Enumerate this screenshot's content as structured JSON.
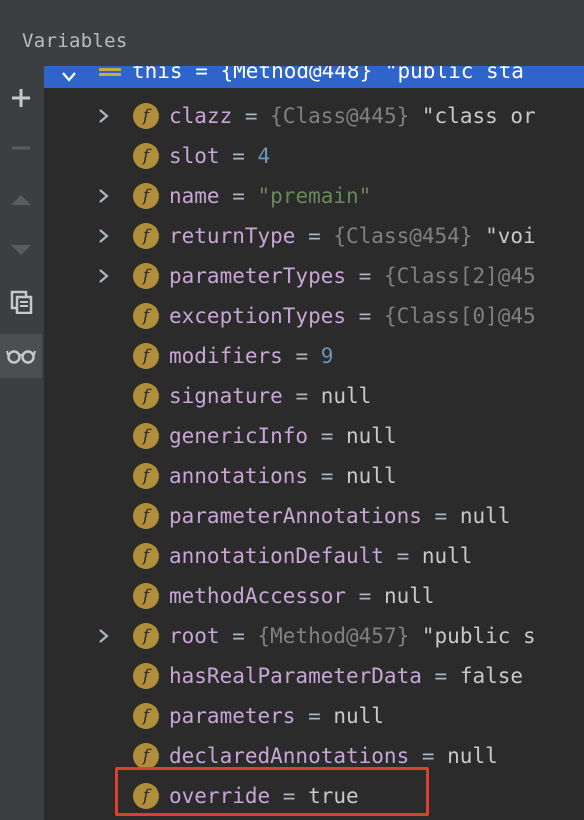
{
  "panel": {
    "title": "Variables"
  },
  "toolbar": {
    "buttons": [
      {
        "icon": "plus-icon"
      },
      {
        "icon": "minus-icon"
      },
      {
        "icon": "arrow-up-icon"
      },
      {
        "icon": "arrow-down-icon"
      },
      {
        "icon": "copy-icon"
      },
      {
        "icon": "glasses-icon"
      }
    ]
  },
  "tree": {
    "root": {
      "text": "this = {Method@448} \"public sta"
    },
    "fields": [
      {
        "name": "clazz",
        "ref": "{Class@445}",
        "value": "\"class or",
        "expandable": true,
        "kind": "ref"
      },
      {
        "name": "slot",
        "value": "4",
        "expandable": false,
        "kind": "num"
      },
      {
        "name": "name",
        "value": "\"premain\"",
        "expandable": true,
        "kind": "str"
      },
      {
        "name": "returnType",
        "ref": "{Class@454}",
        "value": "\"voi",
        "expandable": true,
        "kind": "ref"
      },
      {
        "name": "parameterTypes",
        "ref": "{Class[2]@45",
        "value": "",
        "expandable": true,
        "kind": "ref"
      },
      {
        "name": "exceptionTypes",
        "ref": "{Class[0]@45",
        "value": "",
        "expandable": false,
        "kind": "ref"
      },
      {
        "name": "modifiers",
        "value": "9",
        "expandable": false,
        "kind": "num"
      },
      {
        "name": "signature",
        "value": "null",
        "expandable": false,
        "kind": "plain"
      },
      {
        "name": "genericInfo",
        "value": "null",
        "expandable": false,
        "kind": "plain"
      },
      {
        "name": "annotations",
        "value": "null",
        "expandable": false,
        "kind": "plain"
      },
      {
        "name": "parameterAnnotations",
        "value": "null",
        "expandable": false,
        "kind": "plain"
      },
      {
        "name": "annotationDefault",
        "value": "null",
        "expandable": false,
        "kind": "plain"
      },
      {
        "name": "methodAccessor",
        "value": "null",
        "expandable": false,
        "kind": "plain"
      },
      {
        "name": "root",
        "ref": "{Method@457}",
        "value": "\"public s",
        "expandable": true,
        "kind": "ref"
      },
      {
        "name": "hasRealParameterData",
        "value": "false",
        "expandable": false,
        "kind": "plain"
      },
      {
        "name": "parameters",
        "value": "null",
        "expandable": false,
        "kind": "plain"
      },
      {
        "name": "declaredAnnotations",
        "value": "null",
        "expandable": false,
        "kind": "plain"
      },
      {
        "name": "override",
        "value": "true",
        "expandable": false,
        "kind": "plain"
      }
    ]
  },
  "colors": {
    "highlight": "#e0402a",
    "selection": "#2f65ca",
    "field_icon": "#b08e3a"
  }
}
